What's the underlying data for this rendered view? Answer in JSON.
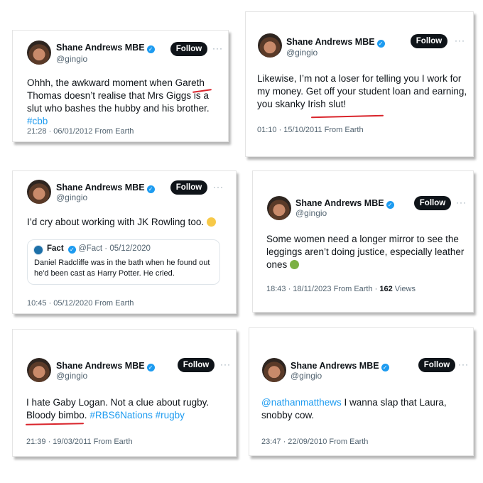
{
  "colors": {
    "accent": "#1d9bf0",
    "underline": "#d9242b",
    "follow_bg": "#0f1419"
  },
  "tweets": [
    {
      "name": "Shane Andrews MBE",
      "handle": "@gingio",
      "follow": "Follow",
      "more": "···",
      "text_a": "Ohhh, the awkward moment when Gareth Thomas doesn’t realise that Mrs Giggs is a ",
      "text_b": "slut",
      "text_c": " who bashes the hubby and his brother. ",
      "hashtag": "#cbb",
      "meta": "21:28 · 06/01/2012 From Earth"
    },
    {
      "name": "Shane Andrews MBE",
      "handle": "@gingio",
      "follow": "Follow",
      "more": "···",
      "text": "Likewise, I’m not a loser for telling you I work for my money.  Get off your student loan and earning, you skanky Irish slut!",
      "meta": "01:10 · 15/10/2011 From Earth"
    },
    {
      "name": "Shane Andrews MBE",
      "handle": "@gingio",
      "follow": "Follow",
      "more": "···",
      "text": "I’d cry about working with JK Rowling too.",
      "emoji": "grimacing-face",
      "quote": {
        "name": "Fact",
        "handle": "@Fact · 05/12/2020",
        "text": "Daniel Radcliffe was in the bath when he found out he'd been cast as Harry Potter. He cried."
      },
      "meta": "10:45 · 05/12/2020 From Earth"
    },
    {
      "name": "Shane Andrews MBE",
      "handle": "@gingio",
      "follow": "Follow",
      "more": "···",
      "text": "Some women need a longer mirror to see the leggings aren’t doing justice, especially leather ones",
      "emoji": "nauseated-face",
      "meta": "18:43 · 18/11/2023 From Earth · ",
      "views_count": "162",
      "views_label": " Views"
    },
    {
      "name": "Shane Andrews MBE",
      "handle": "@gingio",
      "follow": "Follow",
      "more": "···",
      "text": "I hate Gaby Logan. Not a clue about rugby. ",
      "text_b": "Bloody bimbo.",
      "hashtags": " #RBS6Nations #rugby",
      "meta": "21:39 · 19/03/2011 From Earth"
    },
    {
      "name": "Shane Andrews MBE",
      "handle": "@gingio",
      "follow": "Follow",
      "more": "···",
      "mention": "@nathanmatthews",
      "text": " I wanna slap that Laura, snobby cow.",
      "meta": "23:47 · 22/09/2010 From Earth"
    }
  ]
}
